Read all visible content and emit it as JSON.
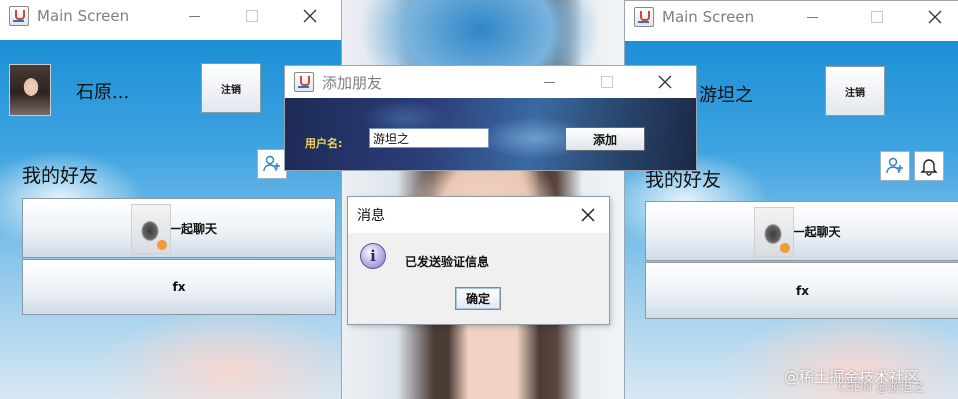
{
  "left_window": {
    "title": "Main Screen",
    "username": "石原...",
    "logout_label": "注销",
    "friends_title": "我的好友",
    "friends": [
      {
        "label": "一起聊天",
        "has_avatar": true
      },
      {
        "label": "fx",
        "has_avatar": false
      }
    ]
  },
  "right_window": {
    "title": "Main Screen",
    "username": "游坦之",
    "logout_label": "注销",
    "friends_title": "我的好友",
    "friends": [
      {
        "label": "一起聊天",
        "has_avatar": true
      },
      {
        "label": "fx",
        "has_avatar": false
      }
    ]
  },
  "add_friend_dialog": {
    "title": "添加朋友",
    "username_label": "用户名:",
    "username_value": "游坦之",
    "add_label": "添加"
  },
  "message_dialog": {
    "title": "消息",
    "message": "已发送验证信息",
    "ok_label": "确定"
  },
  "icons": {
    "add_user": "add-user-icon",
    "bell": "bell-icon",
    "info": "info-icon",
    "close": "close-icon"
  },
  "watermark": "@稀土掘金技术社区",
  "watermark2": "CSDN @游坦之"
}
